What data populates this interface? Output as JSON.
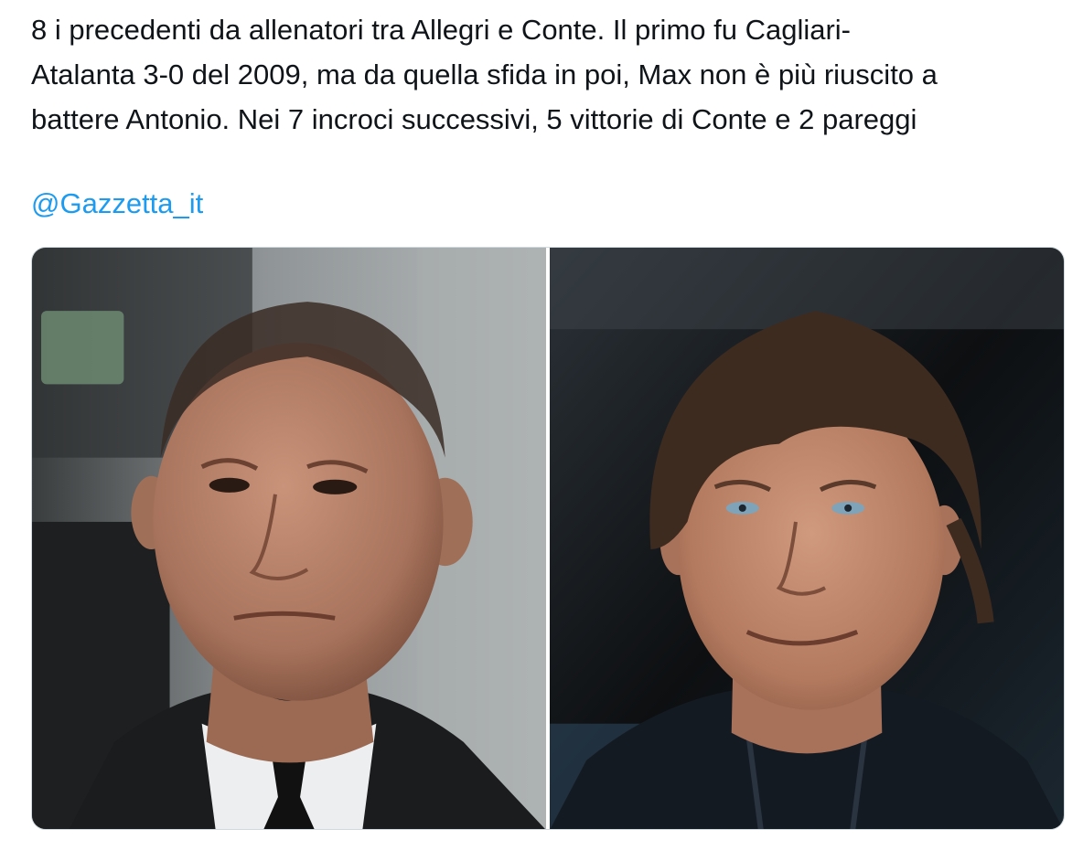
{
  "tweet": {
    "text_lines": [
      "8 i precedenti da allenatori tra Allegri e Conte. Il primo fu Cagliari-",
      "Atalanta 3-0 del 2009, ma da quella sfida in poi, Max non è più riuscito a",
      "battere Antonio. Nei 7 incroci successivi, 5 vittorie di Conte e 2 pareggi"
    ],
    "mention": "@Gazzetta_it",
    "mention_color": "#1d9bf0",
    "text_color": "#0f1419"
  },
  "media": {
    "photos": [
      {
        "subject": "coach-portrait-left",
        "background": "stadium-dugout-grey",
        "attire": "dark suit white shirt black tie"
      },
      {
        "subject": "coach-portrait-right",
        "background": "dark-night-stadium",
        "attire": "dark zip jacket"
      }
    ]
  }
}
